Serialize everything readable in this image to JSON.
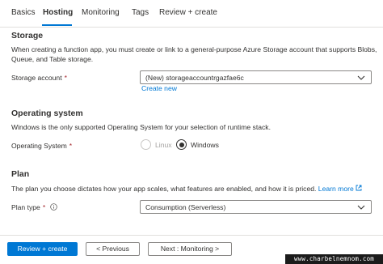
{
  "tabs": [
    {
      "label": "Basics",
      "active": false
    },
    {
      "label": "Hosting",
      "active": true
    },
    {
      "label": "Monitoring",
      "active": false
    },
    {
      "label": "Tags",
      "active": false
    },
    {
      "label": "Review + create",
      "active": false
    }
  ],
  "storage": {
    "title": "Storage",
    "description_line1": "When creating a function app, you must create or link to a general-purpose Azure Storage account that supports Blobs,",
    "description_line2": "Queue, and Table storage.",
    "account_label": "Storage account",
    "required_mark": "*",
    "account_value": "(New) storageaccountrgazfae6c",
    "create_new_link": "Create new"
  },
  "os": {
    "title": "Operating system",
    "description": "Windows is the only supported Operating System for your selection of runtime stack.",
    "label": "Operating System",
    "required_mark": "*",
    "options": [
      {
        "label": "Linux",
        "selected": false,
        "disabled": true
      },
      {
        "label": "Windows",
        "selected": true,
        "disabled": false
      }
    ]
  },
  "plan": {
    "title": "Plan",
    "description": "The plan you choose dictates how your app scales, what features are enabled, and how it is priced.",
    "learn_more": "Learn more",
    "label": "Plan type",
    "required_mark": "*",
    "value": "Consumption (Serverless)"
  },
  "footer": {
    "review_create": "Review + create",
    "previous": "< Previous",
    "next": "Next : Monitoring >"
  },
  "watermark": "www.charbelnemnom.com",
  "colors": {
    "accent": "#0078d4",
    "required": "#a4262c",
    "text": "#323130",
    "border": "#8a8886"
  },
  "icons": {
    "dropdown": "chevron-down-icon",
    "info": "info-icon",
    "external_link": "external-link-icon"
  }
}
